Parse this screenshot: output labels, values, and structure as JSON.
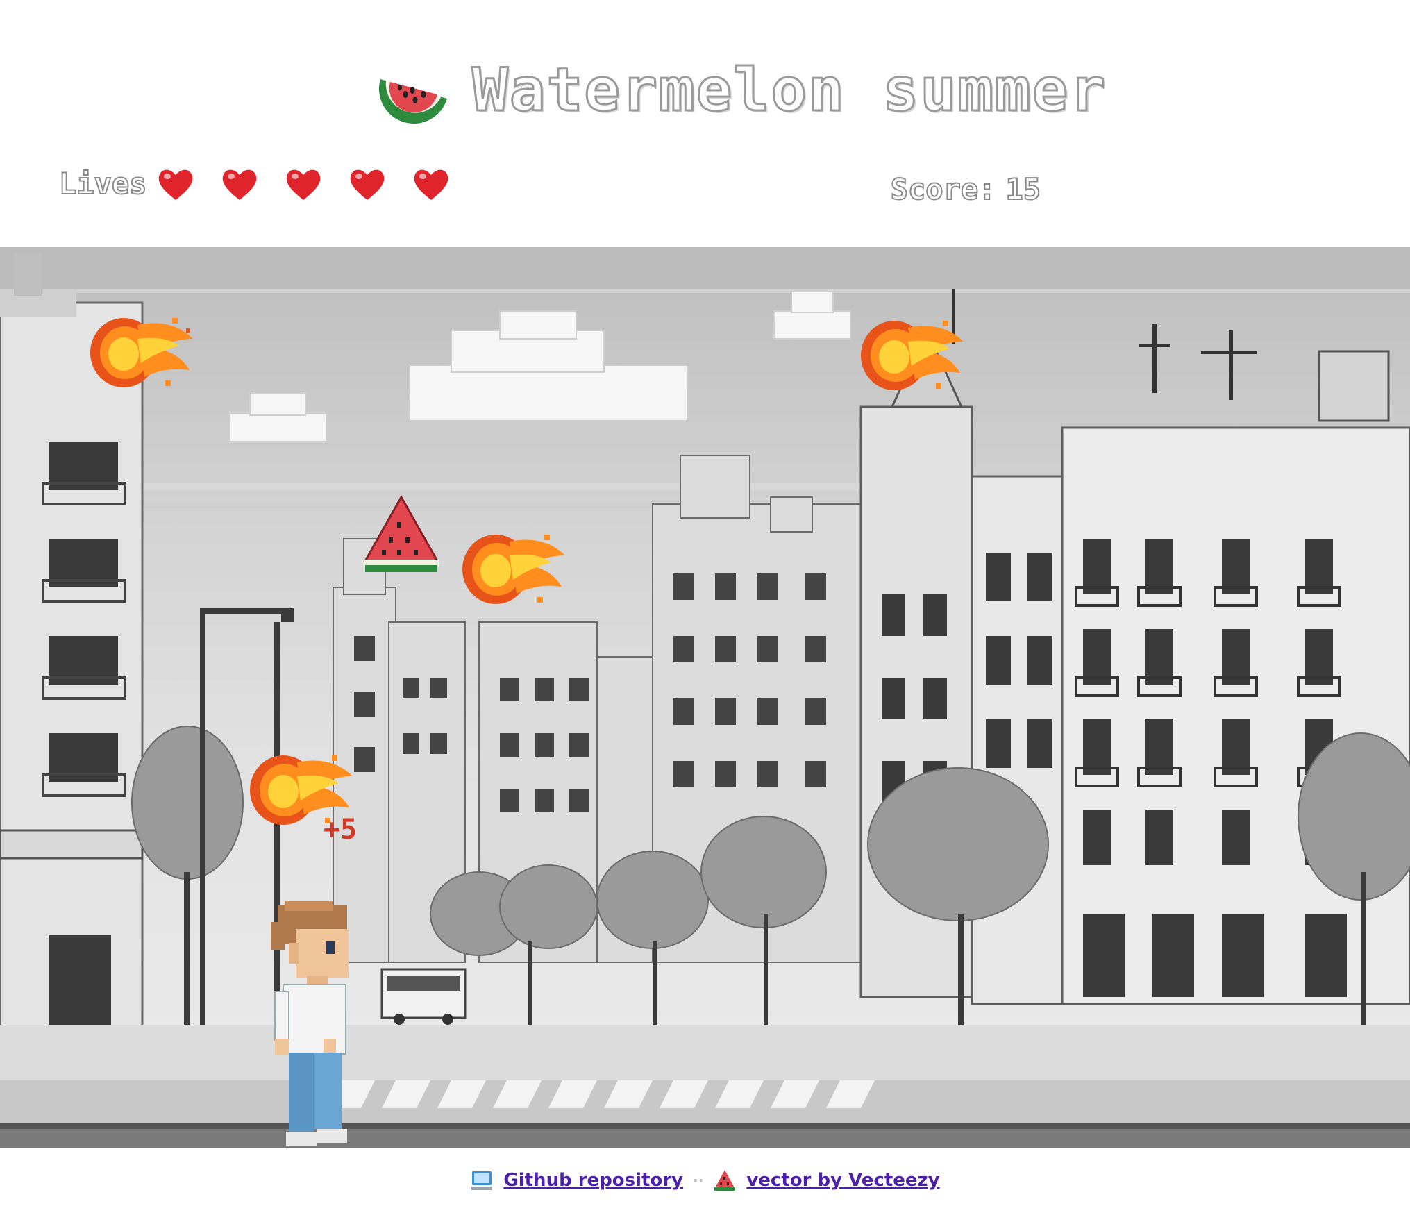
{
  "header": {
    "title": "Watermelon summer",
    "logo_icon": "watermelon-slice-icon"
  },
  "hud": {
    "lives_label": "Lives",
    "lives": 5,
    "heart_icon": "heart-icon",
    "score_label": "Score:",
    "score_value": "15"
  },
  "scene": {
    "background": "grayscale pixel-art city street with buildings, trees, bus and crosswalk",
    "sprites": [
      {
        "type": "fireball"
      },
      {
        "type": "fireball"
      },
      {
        "type": "fireball"
      },
      {
        "type": "fireball"
      },
      {
        "type": "watermelon"
      },
      {
        "type": "player"
      }
    ],
    "floating_score": "+5"
  },
  "footer": {
    "github_icon": "computer-icon",
    "github_label": "Github repository",
    "separator": "··",
    "vecteezy_icon": "watermelon-icon",
    "vecteezy_label": "vector by Vecteezy"
  },
  "colors": {
    "heart": "#e0242c",
    "link": "#4b1fa8",
    "fire_core": "#ffd23a",
    "fire_edge": "#e8531a",
    "melon_red": "#e2474f",
    "melon_green": "#2e8a3c"
  }
}
